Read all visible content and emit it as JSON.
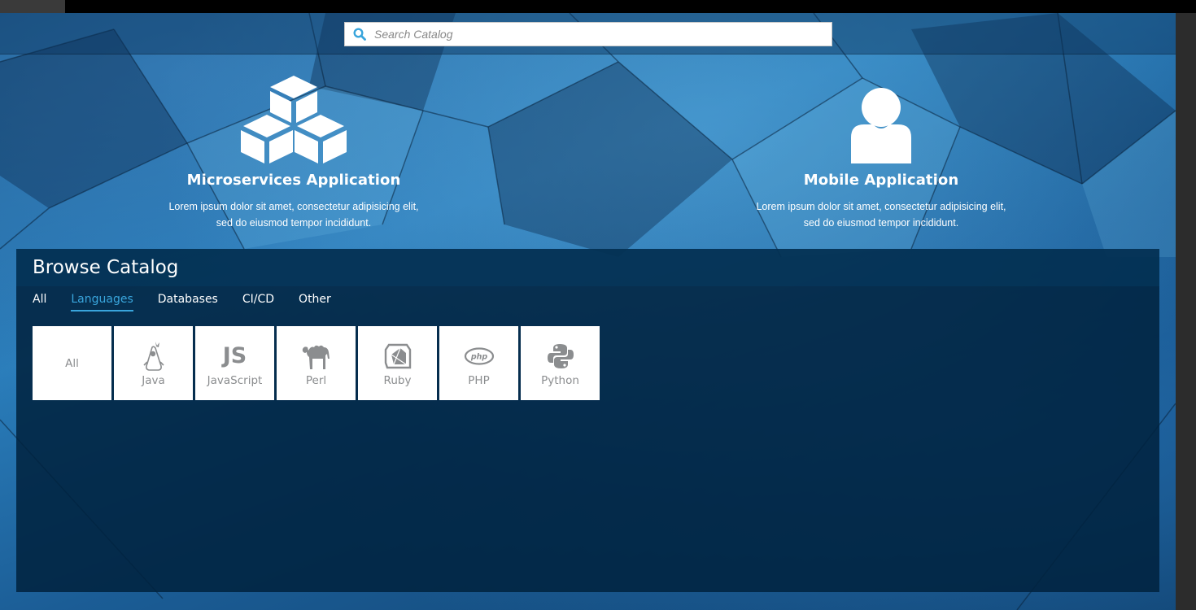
{
  "search": {
    "placeholder": "Search Catalog"
  },
  "features": [
    {
      "title": "Microservices Application",
      "icon": "cubes-icon",
      "description": "Lorem ipsum dolor sit amet, consectetur adipisicing elit, sed do eiusmod tempor incididunt."
    },
    {
      "title": "Mobile Application",
      "icon": "user-icon",
      "description": "Lorem ipsum dolor sit amet, consectetur adipisicing elit, sed do eiusmod tempor incididunt."
    }
  ],
  "catalog": {
    "title": "Browse Catalog",
    "tabs": [
      {
        "label": "All",
        "active": false
      },
      {
        "label": "Languages",
        "active": true
      },
      {
        "label": "Databases",
        "active": false
      },
      {
        "label": "CI/CD",
        "active": false
      },
      {
        "label": "Other",
        "active": false
      }
    ],
    "tiles": [
      {
        "label": "All",
        "icon": ""
      },
      {
        "label": "Java",
        "icon": "java-duke-icon"
      },
      {
        "label": "JavaScript",
        "icon": "js-icon",
        "icon_text": "JS"
      },
      {
        "label": "Perl",
        "icon": "camel-icon"
      },
      {
        "label": "Ruby",
        "icon": "ruby-icon"
      },
      {
        "label": "PHP",
        "icon": "php-icon",
        "icon_text": "php"
      },
      {
        "label": "Python",
        "icon": "python-icon"
      }
    ]
  },
  "colors": {
    "accent": "#39a5dc",
    "tile_text": "#8b8d8f",
    "topbar": "#000000",
    "catalog_bg": "#00223e"
  }
}
